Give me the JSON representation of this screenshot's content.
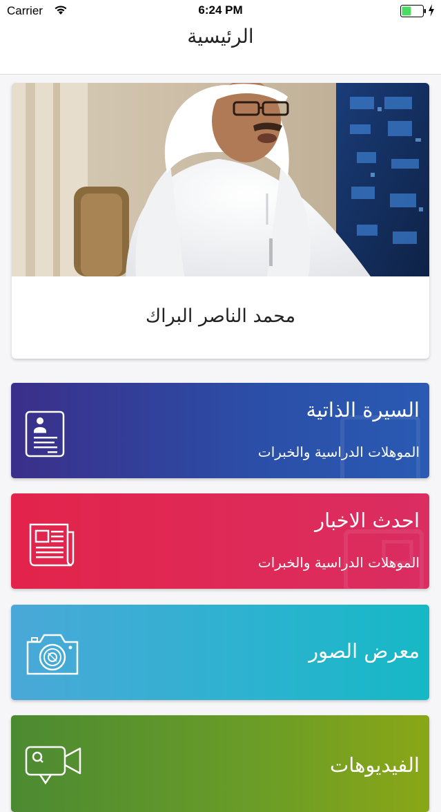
{
  "status_bar": {
    "carrier": "Carrier",
    "time": "6:24 PM",
    "battery_color": "#4cd964"
  },
  "nav": {
    "title": "الرئيسية"
  },
  "profile": {
    "name": "محمد الناصر البراك"
  },
  "menu": [
    {
      "title": "السيرة الذاتية",
      "subtitle": "الموهلات الدراسية والخبرات",
      "icon": "resume-icon",
      "color_start": "#3a2f8a",
      "color_end": "#2a5ab3"
    },
    {
      "title": "احدث الاخبار",
      "subtitle": "الموهلات الدراسية والخبرات",
      "icon": "newspaper-icon",
      "color_start": "#e2244b",
      "color_end": "#da2d62"
    },
    {
      "title": "معرض الصور",
      "icon": "camera-icon",
      "color_start": "#4aa8d8",
      "color_end": "#16b8c6"
    },
    {
      "title": "الفيديوهات",
      "icon": "video-camera-icon",
      "color_start": "#4c8a32",
      "color_end": "#8aa616"
    }
  ]
}
